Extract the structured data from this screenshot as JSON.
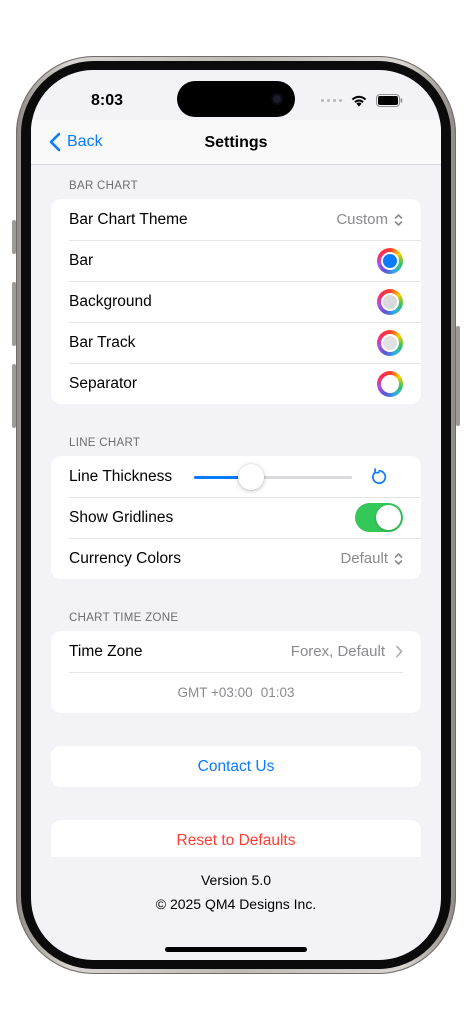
{
  "status_bar": {
    "time": "8:03"
  },
  "nav": {
    "back_label": "Back",
    "title": "Settings"
  },
  "bar_chart": {
    "header": "BAR CHART",
    "rows": [
      {
        "label": "Bar Chart Theme",
        "value": "Custom"
      },
      {
        "label": "Bar",
        "swatch_color": "#0a7aff"
      },
      {
        "label": "Background",
        "swatch_color": "#d9d9dc"
      },
      {
        "label": "Bar Track",
        "swatch_color": "#e1e1e4"
      },
      {
        "label": "Separator",
        "swatch_color": "#ffffff"
      }
    ]
  },
  "line_chart": {
    "header": "LINE CHART",
    "thickness_label": "Line Thickness",
    "thickness_level": 0.36,
    "gridlines_label": "Show Gridlines",
    "gridlines_on": true,
    "currency_label": "Currency Colors",
    "currency_value": "Default"
  },
  "time_zone": {
    "header": "CHART TIME ZONE",
    "label": "Time Zone",
    "value": "Forex, Default",
    "offset": "GMT +03:00",
    "time": "01:03"
  },
  "contact_label": "Contact Us",
  "reset_label": "Reset to Defaults",
  "footer": {
    "version": "Version 5.0",
    "copyright": "© 2025 QM4 Designs Inc."
  },
  "colors": {
    "accent": "#0a7aff",
    "destructive": "#ff3b30",
    "toggle_on": "#34c759"
  },
  "icons": {
    "back": "chevron-left-icon",
    "updown": "chevron-up-down-icon",
    "chevron_right": "chevron-right-icon",
    "reset": "arrow-counterclockwise-icon",
    "wifi": "wifi-icon",
    "battery": "battery-icon",
    "cellular": "cellular-dots-icon"
  }
}
